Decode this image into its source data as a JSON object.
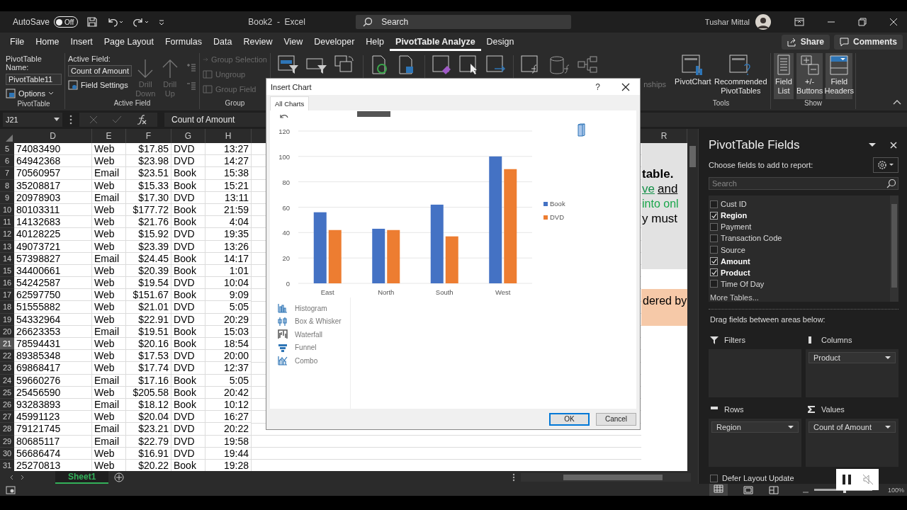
{
  "title_bar": {
    "autosave": {
      "label": "AutoSave",
      "state": "Off",
      "on": false
    },
    "title": "Book2  -  Excel",
    "search": {
      "placeholder": "Search"
    },
    "user": "Tushar Mittal"
  },
  "menu": {
    "tabs": [
      {
        "label": "File",
        "selected": false
      },
      {
        "label": "Home",
        "selected": false
      },
      {
        "label": "Insert",
        "selected": false
      },
      {
        "label": "Page Layout",
        "selected": false
      },
      {
        "label": "Formulas",
        "selected": false
      },
      {
        "label": "Data",
        "selected": false
      },
      {
        "label": "Review",
        "selected": false
      },
      {
        "label": "View",
        "selected": false
      },
      {
        "label": "Developer",
        "selected": false
      },
      {
        "label": "Help",
        "selected": false
      },
      {
        "label": "PivotTable Analyze",
        "selected": true
      },
      {
        "label": "Design",
        "selected": false
      }
    ],
    "share": "Share",
    "comments": "Comments"
  },
  "ribbon": {
    "pivottable": {
      "name_label": "PivotTable Name:",
      "name": "PivotTable11",
      "options": "Options",
      "caption": "PivotTable"
    },
    "active_field": {
      "label": "Active Field:",
      "value": "Count of Amount",
      "settings": "Field Settings",
      "drill": [
        {
          "label": "Drill Down",
          "disabled": true
        },
        {
          "label": "Drill Up",
          "disabled": true
        }
      ],
      "caption": "Active Field"
    },
    "group": {
      "items": [
        {
          "label": "Group Selection",
          "disabled": true
        },
        {
          "label": "Ungroup",
          "disabled": true
        },
        {
          "label": "Group Field",
          "disabled": true
        }
      ],
      "caption": "Group"
    },
    "partial_label": "nships",
    "tools": {
      "items": [
        "PivotChart",
        "Recommended PivotTables"
      ],
      "caption": "Tools"
    },
    "show": {
      "items": [
        {
          "label": "Field List",
          "on": true
        },
        {
          "label": "+/- Buttons",
          "on": true
        },
        {
          "label": "Field Headers",
          "on": true
        }
      ],
      "caption": "Show"
    }
  },
  "formula_bar": {
    "name_box": "J21",
    "formula": "Count of Amount"
  },
  "sheet": {
    "columns": [
      "D",
      "E",
      "F",
      "G",
      "H"
    ],
    "right_column": "R",
    "rows": [
      {
        "header": "5",
        "selected": false,
        "cells": [
          "74083490",
          "Web",
          "$17.85",
          "DVD",
          "13:27"
        ]
      },
      {
        "header": "6",
        "selected": false,
        "cells": [
          "64942368",
          "Web",
          "$23.98",
          "DVD",
          "14:27"
        ]
      },
      {
        "header": "7",
        "selected": false,
        "cells": [
          "70560957",
          "Email",
          "$23.51",
          "Book",
          "15:38"
        ]
      },
      {
        "header": "8",
        "selected": false,
        "cells": [
          "35208817",
          "Web",
          "$15.33",
          "Book",
          "15:21"
        ]
      },
      {
        "header": "9",
        "selected": false,
        "cells": [
          "20978903",
          "Email",
          "$17.30",
          "DVD",
          "13:11"
        ]
      },
      {
        "header": "10",
        "selected": false,
        "cells": [
          "80103311",
          "Web",
          "$177.72",
          "Book",
          "21:59"
        ]
      },
      {
        "header": "11",
        "selected": false,
        "cells": [
          "14132683",
          "Web",
          "$21.76",
          "Book",
          "4:04"
        ]
      },
      {
        "header": "12",
        "selected": false,
        "cells": [
          "40128225",
          "Web",
          "$15.92",
          "DVD",
          "19:35"
        ]
      },
      {
        "header": "13",
        "selected": false,
        "cells": [
          "49073721",
          "Web",
          "$23.39",
          "DVD",
          "13:26"
        ]
      },
      {
        "header": "14",
        "selected": false,
        "cells": [
          "57398827",
          "Email",
          "$24.45",
          "Book",
          "14:17"
        ]
      },
      {
        "header": "15",
        "selected": false,
        "cells": [
          "34400661",
          "Web",
          "$20.39",
          "Book",
          "1:01"
        ]
      },
      {
        "header": "16",
        "selected": false,
        "cells": [
          "54242587",
          "Web",
          "$19.54",
          "DVD",
          "10:04"
        ]
      },
      {
        "header": "17",
        "selected": false,
        "cells": [
          "62597750",
          "Web",
          "$151.67",
          "Book",
          "9:09"
        ]
      },
      {
        "header": "18",
        "selected": false,
        "cells": [
          "51555882",
          "Web",
          "$21.01",
          "DVD",
          "5:05"
        ]
      },
      {
        "header": "19",
        "selected": false,
        "cells": [
          "54332964",
          "Web",
          "$22.91",
          "DVD",
          "20:29"
        ]
      },
      {
        "header": "20",
        "selected": false,
        "cells": [
          "26623353",
          "Email",
          "$19.51",
          "Book",
          "15:03"
        ]
      },
      {
        "header": "21",
        "selected": true,
        "cells": [
          "78594431",
          "Web",
          "$20.16",
          "Book",
          "18:54"
        ]
      },
      {
        "header": "22",
        "selected": false,
        "cells": [
          "89385348",
          "Web",
          "$17.53",
          "DVD",
          "20:00"
        ]
      },
      {
        "header": "23",
        "selected": false,
        "cells": [
          "69868417",
          "Web",
          "$17.74",
          "DVD",
          "12:37"
        ]
      },
      {
        "header": "24",
        "selected": false,
        "cells": [
          "59660276",
          "Email",
          "$17.16",
          "Book",
          "5:05"
        ]
      },
      {
        "header": "25",
        "selected": false,
        "cells": [
          "25456590",
          "Web",
          "$205.58",
          "Book",
          "20:42"
        ]
      },
      {
        "header": "26",
        "selected": false,
        "cells": [
          "93283893",
          "Email",
          "$18.12",
          "Book",
          "10:12"
        ]
      },
      {
        "header": "27",
        "selected": false,
        "cells": [
          "45991123",
          "Web",
          "$20.04",
          "DVD",
          "16:27"
        ]
      },
      {
        "header": "28",
        "selected": false,
        "cells": [
          "79121745",
          "Email",
          "$23.21",
          "DVD",
          "20:22"
        ]
      },
      {
        "header": "29",
        "selected": false,
        "cells": [
          "80685117",
          "Email",
          "$22.79",
          "DVD",
          "19:58"
        ]
      },
      {
        "header": "30",
        "selected": false,
        "cells": [
          "56686474",
          "Web",
          "$16.91",
          "DVD",
          "19:44"
        ]
      },
      {
        "header": "31",
        "selected": false,
        "cells": [
          "25270813",
          "Web",
          "$20.22",
          "Book",
          "19:28"
        ]
      }
    ],
    "notes": [
      {
        "segments": [
          {
            "text": "table.",
            "kind": "bold"
          }
        ]
      },
      {
        "segments": [
          {
            "text": "ve",
            "kind": "link"
          },
          {
            "text": "and",
            "kind": "underline"
          }
        ]
      },
      {
        "segments": [
          {
            "text": "into onl",
            "kind": "green"
          }
        ]
      },
      {
        "segments": [
          {
            "text": "y must",
            "kind": "plain"
          }
        ]
      }
    ],
    "peach_note": "dered by"
  },
  "sheet_tabs": [
    {
      "label": "Sheet1",
      "selected": true
    }
  ],
  "status_bar": {
    "zoom_slider": {
      "level": 0.5
    },
    "zoom": "100%"
  },
  "dialog": {
    "title": "Insert Chart",
    "help": "?",
    "tabs": [
      {
        "label": "All Charts",
        "selected": true
      }
    ],
    "chart_data": {
      "type": "bar",
      "categories": [
        "East",
        "North",
        "South",
        "West"
      ],
      "series": [
        {
          "name": "Book",
          "color": "#4472c4",
          "values": [
            56,
            43,
            62,
            100
          ]
        },
        {
          "name": "DVD",
          "color": "#ed7d31",
          "values": [
            42,
            42,
            37,
            90
          ]
        }
      ],
      "grid": true,
      "ylim": [
        0,
        120
      ],
      "yticks": [
        0,
        20,
        40,
        60,
        80,
        100,
        120
      ]
    },
    "chart_types": [
      {
        "label": "Histogram",
        "kind": "histogram"
      },
      {
        "label": "Box & Whisker",
        "kind": "box"
      },
      {
        "label": "Waterfall",
        "kind": "waterfall"
      },
      {
        "label": "Funnel",
        "kind": "funnel"
      },
      {
        "label": "Combo",
        "kind": "combo"
      }
    ],
    "ok": "OK",
    "cancel": "Cancel"
  },
  "fields_panel": {
    "title": "PivotTable Fields",
    "subtitle": "Choose fields to add to report:",
    "search": {
      "placeholder": "Search"
    },
    "fields": [
      {
        "label": "Cust ID",
        "checked": false
      },
      {
        "label": "Region",
        "checked": true
      },
      {
        "label": "Payment",
        "checked": false
      },
      {
        "label": "Transaction Code",
        "checked": false
      },
      {
        "label": "Source",
        "checked": false
      },
      {
        "label": "Amount",
        "checked": true
      },
      {
        "label": "Product",
        "checked": true
      },
      {
        "label": "Time Of Day",
        "checked": false
      }
    ],
    "more": "More Tables...",
    "drag_hint": "Drag fields between areas below:",
    "areas": [
      {
        "label": "Filters",
        "kind": "filters"
      },
      {
        "label": "Columns",
        "kind": "columns",
        "items": [
          "Product"
        ]
      },
      {
        "label": "Rows",
        "kind": "rows",
        "items": [
          "Region"
        ]
      },
      {
        "label": "Values",
        "kind": "values",
        "items": [
          "Count of Amount"
        ]
      }
    ],
    "defer": {
      "label": "Defer Layout Update",
      "checked": false
    }
  }
}
